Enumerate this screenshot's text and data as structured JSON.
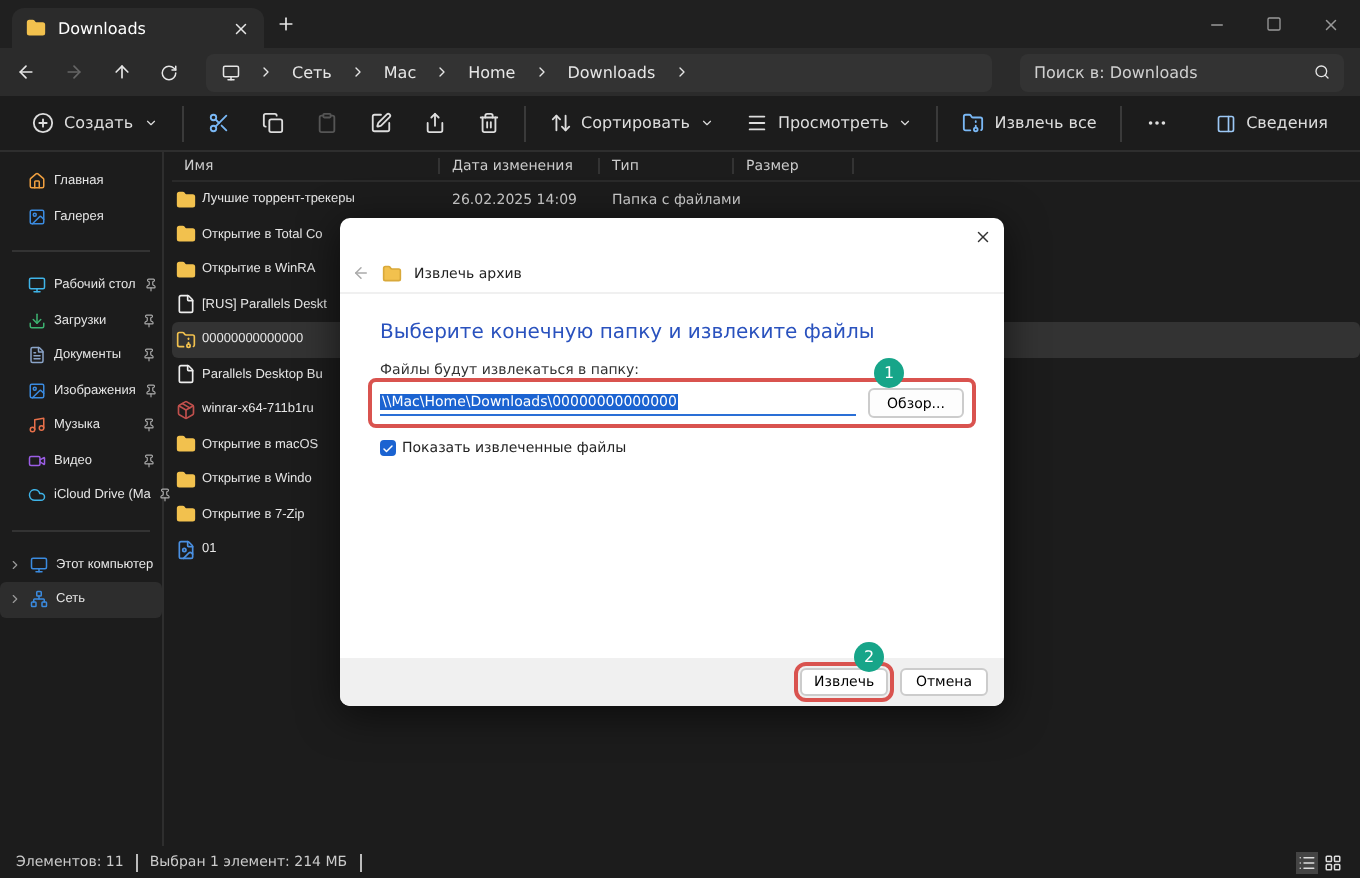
{
  "tab": {
    "title": "Downloads"
  },
  "address": {
    "crumbs": [
      "Сеть",
      "Mac",
      "Home",
      "Downloads"
    ]
  },
  "search": {
    "placeholder": "Поиск в: Downloads"
  },
  "toolbar": [
    {
      "kind": "labeled",
      "label": "Создать",
      "dropdown": true,
      "disabled": false
    },
    {
      "kind": "icon",
      "disabled": false
    },
    {
      "kind": "icon",
      "disabled": false
    },
    {
      "kind": "icon",
      "disabled": true
    },
    {
      "kind": "icon",
      "disabled": false
    },
    {
      "kind": "icon",
      "disabled": false
    },
    {
      "kind": "icon",
      "disabled": false
    },
    {
      "kind": "labeled",
      "label": "Сортировать",
      "dropdown": true,
      "disabled": false
    },
    {
      "kind": "labeled",
      "label": "Просмотреть",
      "dropdown": true,
      "disabled": false
    },
    {
      "kind": "labeled",
      "label": "Извлечь все",
      "dropdown": false,
      "disabled": false
    },
    {
      "kind": "icon",
      "disabled": false
    }
  ],
  "details_button": {
    "label": "Сведения"
  },
  "sidebar": {
    "groups": [
      [
        {
          "label": "Главная",
          "pinned": false,
          "expandable": false,
          "selected": false
        },
        {
          "label": "Галерея",
          "pinned": false,
          "expandable": false,
          "selected": false
        }
      ],
      [
        {
          "label": "Рабочий стол",
          "pinned": true,
          "expandable": false,
          "selected": false
        },
        {
          "label": "Загрузки",
          "pinned": true,
          "expandable": false,
          "selected": false
        },
        {
          "label": "Документы",
          "pinned": true,
          "expandable": false,
          "selected": false
        },
        {
          "label": "Изображения",
          "pinned": true,
          "expandable": false,
          "selected": false
        },
        {
          "label": "Музыка",
          "pinned": true,
          "expandable": false,
          "selected": false
        },
        {
          "label": "Видео",
          "pinned": true,
          "expandable": false,
          "selected": false
        },
        {
          "label": "iCloud Drive (Ma",
          "pinned": true,
          "expandable": false,
          "selected": false
        }
      ],
      [
        {
          "label": "Этот компьютер",
          "pinned": false,
          "expandable": true,
          "selected": false
        },
        {
          "label": "Сеть",
          "pinned": false,
          "expandable": true,
          "selected": true
        }
      ]
    ]
  },
  "files": {
    "columns": [
      "Имя",
      "Дата изменения",
      "Тип",
      "Размер"
    ],
    "rows": [
      {
        "name": "Лучшие торрент-трекеры",
        "kind": "folder",
        "selected": false,
        "date": "26.02.2025 14:09",
        "type": "Папка с файлами"
      },
      {
        "name": "Открытие в Total Co",
        "kind": "folder",
        "selected": false
      },
      {
        "name": "Открытие в WinRA",
        "kind": "folder",
        "selected": false
      },
      {
        "name": "[RUS] Parallels Deskt",
        "kind": "file",
        "selected": false
      },
      {
        "name": "00000000000000",
        "kind": "archive",
        "selected": true
      },
      {
        "name": "Parallels Desktop Bu",
        "kind": "file",
        "selected": false
      },
      {
        "name": "winrar-x64-711b1ru",
        "kind": "installer",
        "selected": false
      },
      {
        "name": "Открытие в macOS",
        "kind": "folder",
        "selected": false
      },
      {
        "name": "Открытие в Windo",
        "kind": "folder",
        "selected": false
      },
      {
        "name": "Открытие в 7-Zip",
        "kind": "folder",
        "selected": false
      },
      {
        "name": "01",
        "kind": "image",
        "selected": false
      }
    ]
  },
  "dialog": {
    "title": "Извлечь архив",
    "heading": "Выберите конечную папку и извлеките файлы",
    "field_label": "Файлы будут извлекаться в папку:",
    "path": "\\\\Mac\\Home\\Downloads\\00000000000000",
    "path_highlighted": true,
    "path_badge": "1",
    "browse": "Обзор...",
    "show_files": {
      "label": "Показать извлеченные файлы",
      "checked": true
    },
    "buttons": [
      {
        "label": "Извлечь",
        "highlighted": true,
        "badge": "2"
      },
      {
        "label": "Отмена",
        "highlighted": false
      }
    ]
  },
  "status": {
    "items": [
      "Элементов: 11",
      "Выбран 1 элемент: 214 МБ"
    ],
    "views": [
      {
        "selected": true
      },
      {
        "selected": false
      }
    ]
  }
}
